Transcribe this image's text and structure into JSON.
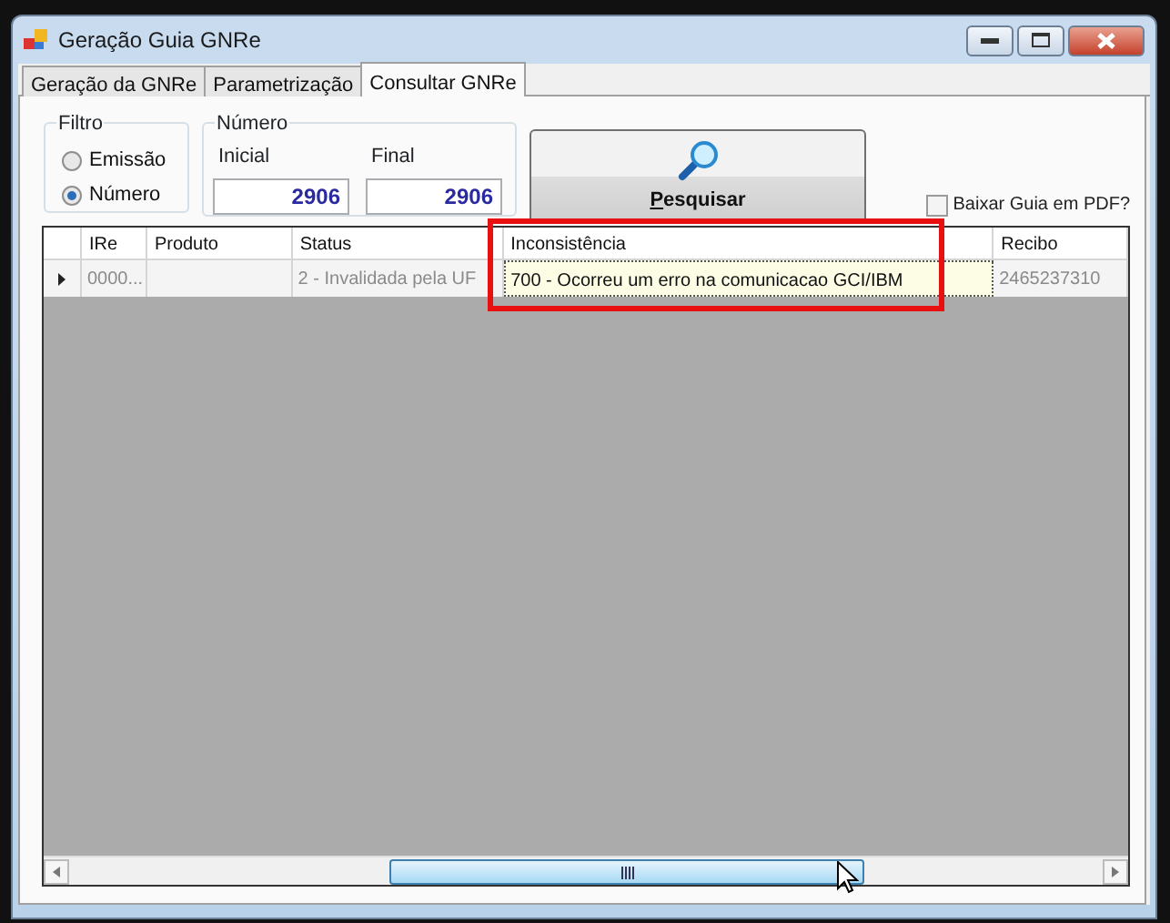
{
  "window": {
    "title": "Geração Guia GNRe"
  },
  "tabs": [
    {
      "label": "Geração da GNRe",
      "selected": false
    },
    {
      "label": "Parametrização",
      "selected": false
    },
    {
      "label": "Consultar GNRe",
      "selected": true
    }
  ],
  "filter": {
    "title": "Filtro",
    "options": [
      {
        "label": "Emissão",
        "selected": false
      },
      {
        "label": "Número",
        "selected": true
      }
    ]
  },
  "number": {
    "title": "Número",
    "fields": [
      {
        "label": "Inicial",
        "value": "2906"
      },
      {
        "label": "Final",
        "value": "2906"
      }
    ]
  },
  "search_button": {
    "label": "Pesquisar"
  },
  "pdf_checkbox": {
    "label": "Baixar Guia em PDF?",
    "checked": false
  },
  "grid": {
    "columns": [
      "IRe",
      "Produto",
      "Status",
      "Inconsistência",
      "Recibo"
    ],
    "rows": [
      {
        "current": true,
        "cells": [
          {
            "text": "0000...",
            "focused": false
          },
          {
            "focused": false
          },
          {
            "text": "2 - Invalidada pela UF",
            "focused": false
          },
          {
            "text": "700 - Ocorreu um erro na comunicacao GCI/IBM",
            "focused": true
          },
          {
            "text": "2465237310",
            "focused": false
          }
        ]
      }
    ]
  }
}
